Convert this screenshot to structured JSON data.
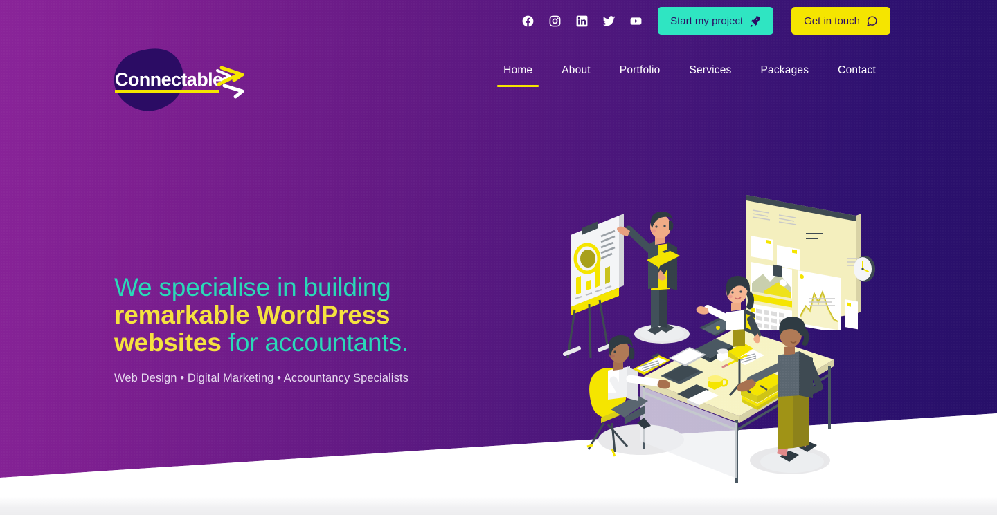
{
  "brand": {
    "name": "Connectable",
    "logo_blob_color": "#2b0c64",
    "logo_underline_color": "#f5e500",
    "logo_text_color": "#ffffff"
  },
  "theme": {
    "bg_gradient_from": "#8a2499",
    "bg_gradient_to": "#260f68",
    "accent_yellow": "#f5e500",
    "accent_teal": "#2fe5c2",
    "headline_teal": "#2ad9b8",
    "headline_yellow": "#f5e23f",
    "button_text": "#2b0c64",
    "section_bg": "#ffffff"
  },
  "topbar": {
    "socials": [
      {
        "name": "facebook-icon",
        "label": "Facebook"
      },
      {
        "name": "instagram-icon",
        "label": "Instagram"
      },
      {
        "name": "linkedin-icon",
        "label": "LinkedIn"
      },
      {
        "name": "twitter-icon",
        "label": "Twitter"
      },
      {
        "name": "youtube-icon",
        "label": "YouTube"
      }
    ],
    "start_project_label": "Start my project",
    "start_project_icon": "rocket-icon",
    "get_in_touch_label": "Get in touch",
    "get_in_touch_icon": "speech-bubble-icon"
  },
  "nav": {
    "active": "Home",
    "items": [
      {
        "label": "Home"
      },
      {
        "label": "About"
      },
      {
        "label": "Portfolio"
      },
      {
        "label": "Services"
      },
      {
        "label": "Packages"
      },
      {
        "label": "Contact"
      }
    ]
  },
  "hero": {
    "headline_line1_a": "We specialise",
    "headline_line1_b": " in building",
    "headline_line2": "remarkable WordPress",
    "headline_line3_a": "websites",
    "headline_line3_b": " for accountants",
    "headline_line3_c": ".",
    "subtitle": "Web Design • Digital Marketing • Accountancy Specialists"
  },
  "illustration": {
    "alt": "Isometric illustration of a four person team meeting around an office desk with laptops, a flip chart and a wall mounted analytics dashboard",
    "elements": [
      "flip-chart",
      "dashboard-screen",
      "wall-clock",
      "desk",
      "laptop",
      "desktop-monitor",
      "coffee-mug",
      "notebook",
      "books",
      "clipboard",
      "person-presenting",
      "person-seated-chair",
      "person-on-stool",
      "person-standing"
    ]
  }
}
